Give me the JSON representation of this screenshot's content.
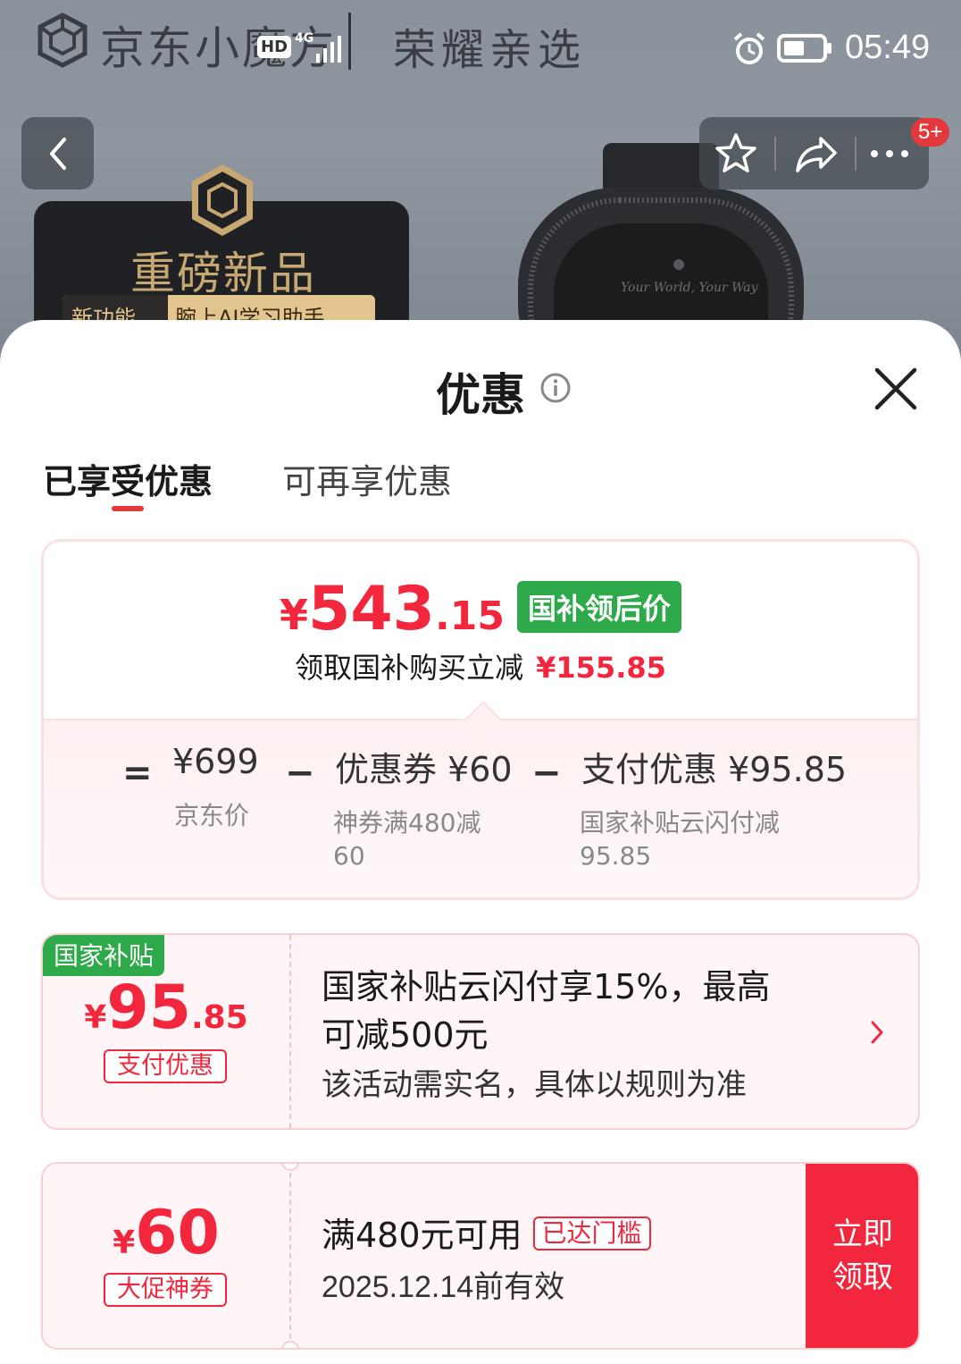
{
  "status_bar": {
    "brand": "京东小魔方",
    "hd": "HD",
    "network": "4G",
    "brand2": "荣耀亲选",
    "time": "05:49"
  },
  "top_actions": {
    "badge_count": "5+"
  },
  "promo_banner": {
    "title": "重磅新品",
    "tag_left": "新功能",
    "tag_right": "腕上AI学习助手"
  },
  "sheet": {
    "title": "优惠",
    "tabs": [
      {
        "label": "已享受优惠",
        "active": true
      },
      {
        "label": "可再享优惠",
        "active": false
      }
    ]
  },
  "summary": {
    "currency": "¥",
    "price_int": "543",
    "price_dec": ".15",
    "price_tag": "国补领后价",
    "subtitle": "领取国补购买立减",
    "subtitle_amount": "¥155.85",
    "breakdown": [
      {
        "operator": "=",
        "main": "¥699",
        "sub": "京东价"
      },
      {
        "operator": "−",
        "main": "优惠券 ¥60",
        "sub": "神券满480减\n60"
      },
      {
        "operator": "−",
        "main": "支付优惠 ¥95.85",
        "sub": "国家补贴云闪付减\n95.85"
      }
    ]
  },
  "coupons": [
    {
      "corner_tag": "国家补贴",
      "currency": "¥",
      "amount_int": "95",
      "amount_dec": ".85",
      "label": "支付优惠",
      "title_line1": "国家补贴云闪付享15%，最高",
      "title_line2": "可减500元",
      "desc": "该活动需实名，具体以规则为准"
    },
    {
      "currency": "¥",
      "amount_int": "60",
      "label": "大促神券",
      "title": "满480元可用",
      "threshold_tag": "已达门槛",
      "desc": "2025.12.14前有效",
      "button": "立即领取"
    }
  ],
  "colors": {
    "accent_red": "#f2263c",
    "gov_green": "#2eaa4b",
    "tab_underline": "#e4393c"
  }
}
